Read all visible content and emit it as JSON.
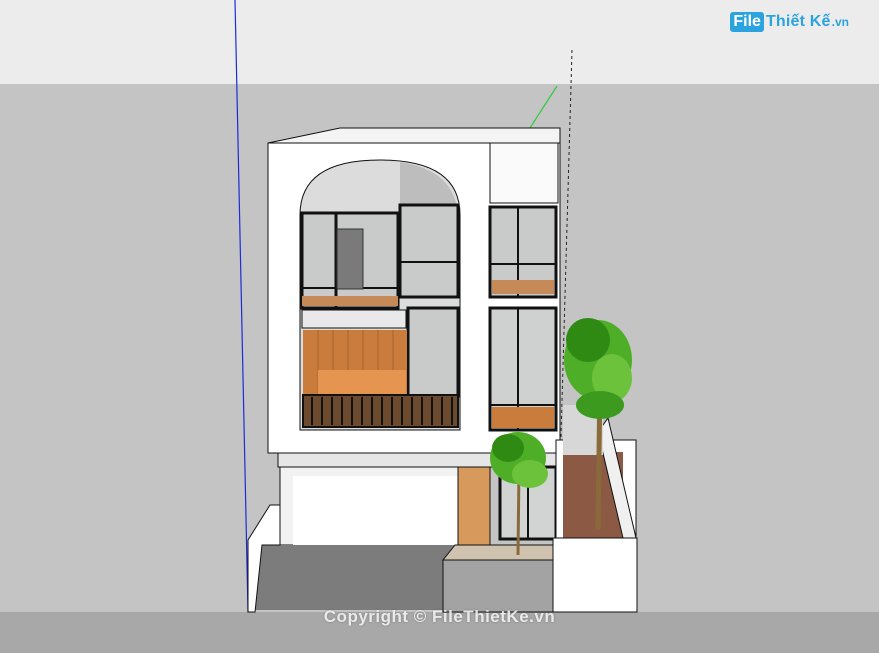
{
  "watermark": {
    "logo_box_text": "File",
    "logo_main_text": "Thiết Kế",
    "logo_tld": ".vn",
    "copyright": "Copyright © FileThietKe.vn"
  },
  "colors": {
    "sky": "#e8e8e8",
    "ground": "#c4c4c4",
    "road": "#a9a9a9",
    "wall": "#ffffff",
    "wood": "#c97c3c",
    "glass": "#cfd2d2",
    "frame": "#111111",
    "plant": "#3c9a1e",
    "axis_blue": "#1d2bd8",
    "axis_green": "#2ecc40",
    "accent": "#2aa3df"
  },
  "icons": {
    "brand": "filethietke-logo"
  }
}
